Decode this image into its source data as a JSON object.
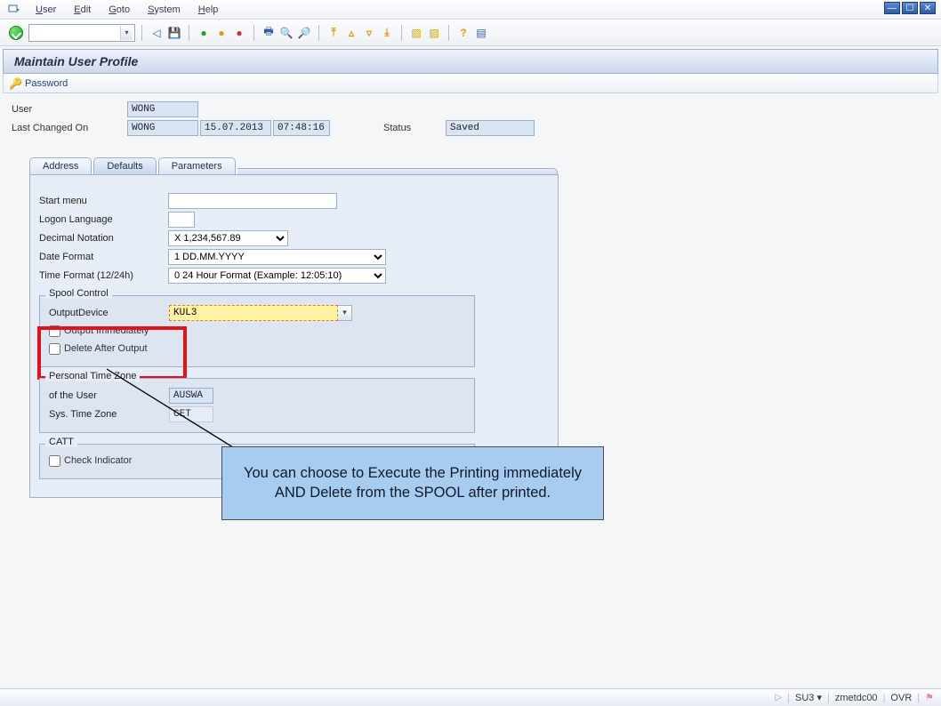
{
  "menu": {
    "items": [
      "User",
      "Edit",
      "Goto",
      "System",
      "Help"
    ]
  },
  "title": "Maintain User Profile",
  "linkbar": {
    "password": "Password"
  },
  "header": {
    "user_lbl": "User",
    "user_val": "WONG",
    "lastchg_lbl": "Last Changed On",
    "lastchg_by": "WONG",
    "lastchg_date": "15.07.2013",
    "lastchg_time": "07:48:16",
    "status_lbl": "Status",
    "status_val": "Saved"
  },
  "tabs": [
    "Address",
    "Defaults",
    "Parameters"
  ],
  "defaults": {
    "start_menu_lbl": "Start menu",
    "start_menu_val": "",
    "logon_lang_lbl": "Logon Language",
    "logon_lang_val": "",
    "decimal_lbl": "Decimal Notation",
    "decimal_val": "X 1,234,567.89",
    "dateformat_lbl": "Date Format",
    "dateformat_val": "1 DD.MM.YYYY",
    "timeformat_lbl": "Time Format (12/24h)",
    "timeformat_val": "0 24 Hour Format (Example: 12:05:10)"
  },
  "spool": {
    "group": "Spool Control",
    "outdev_lbl": "OutputDevice",
    "outdev_val": "KUL3",
    "out_imm_lbl": "Output Immediately",
    "del_after_lbl": "Delete After Output"
  },
  "tz": {
    "group": "Personal Time Zone",
    "user_lbl": "of the User",
    "user_val": "AUSWA",
    "sys_lbl": "Sys. Time Zone",
    "sys_val": "CET"
  },
  "catt": {
    "group": "CATT",
    "chk_lbl": "Check Indicator"
  },
  "annotation": "You can choose to Execute the Printing immediately AND Delete from the SPOOL after printed.",
  "status": {
    "tcode": "SU3",
    "system": "zmetdc00",
    "mode": "OVR"
  }
}
